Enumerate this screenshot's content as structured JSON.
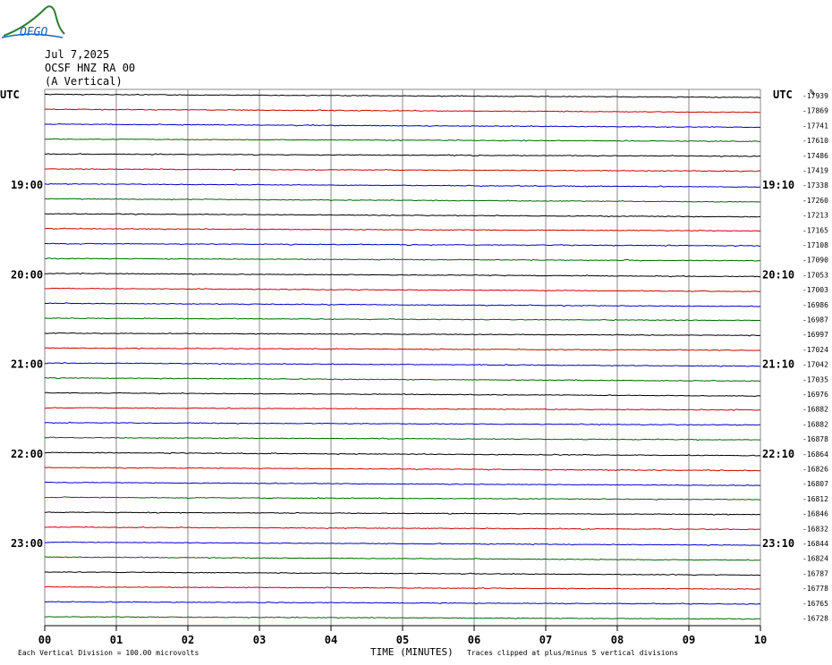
{
  "header": {
    "logo_text": "OFGO",
    "date": "Jul 7,2025",
    "station": "OCSF HNZ RA 00",
    "component": "(A Vertical)"
  },
  "chart_data": {
    "type": "line",
    "title": "OCSF HNZ RA 00",
    "left_axis_label": "UTC",
    "right_axis_label": "UTC",
    "right_units": "%",
    "xlabel": "TIME (MINUTES)",
    "x_ticks": [
      "00",
      "01",
      "02",
      "03",
      "04",
      "05",
      "06",
      "07",
      "08",
      "09",
      "10"
    ],
    "xlim": [
      0,
      10
    ],
    "left_hour_labels": [
      {
        "label": "19:00",
        "trace_index": 6
      },
      {
        "label": "20:00",
        "trace_index": 12
      },
      {
        "label": "21:00",
        "trace_index": 18
      },
      {
        "label": "22:00",
        "trace_index": 24
      },
      {
        "label": "23:00",
        "trace_index": 30
      }
    ],
    "right_hour_labels": [
      {
        "label": "19:10",
        "trace_index": 6
      },
      {
        "label": "20:10",
        "trace_index": 12
      },
      {
        "label": "21:10",
        "trace_index": 18
      },
      {
        "label": "22:10",
        "trace_index": 24
      },
      {
        "label": "23:10",
        "trace_index": 30
      }
    ],
    "trace_colors": [
      "#000000",
      "#cc0000",
      "#0000cc",
      "#006600"
    ],
    "trace_offsets": [
      -17939,
      -17869,
      -17741,
      -17610,
      -17486,
      -17419,
      -17338,
      -17260,
      -17213,
      -17165,
      -17108,
      -17090,
      -17053,
      -17003,
      -16986,
      -16987,
      -16997,
      -17024,
      -17042,
      -17035,
      -16976,
      -16882,
      -16882,
      -16878,
      -16864,
      -16826,
      -16807,
      -16812,
      -16846,
      -16832,
      -16844,
      -16824,
      -16787,
      -16778,
      -16765,
      -16728
    ],
    "footer_left": "Each Vertical Division =  100.00 microvolts",
    "footer_right": "Traces clipped at plus/minus 5 vertical divisions"
  }
}
